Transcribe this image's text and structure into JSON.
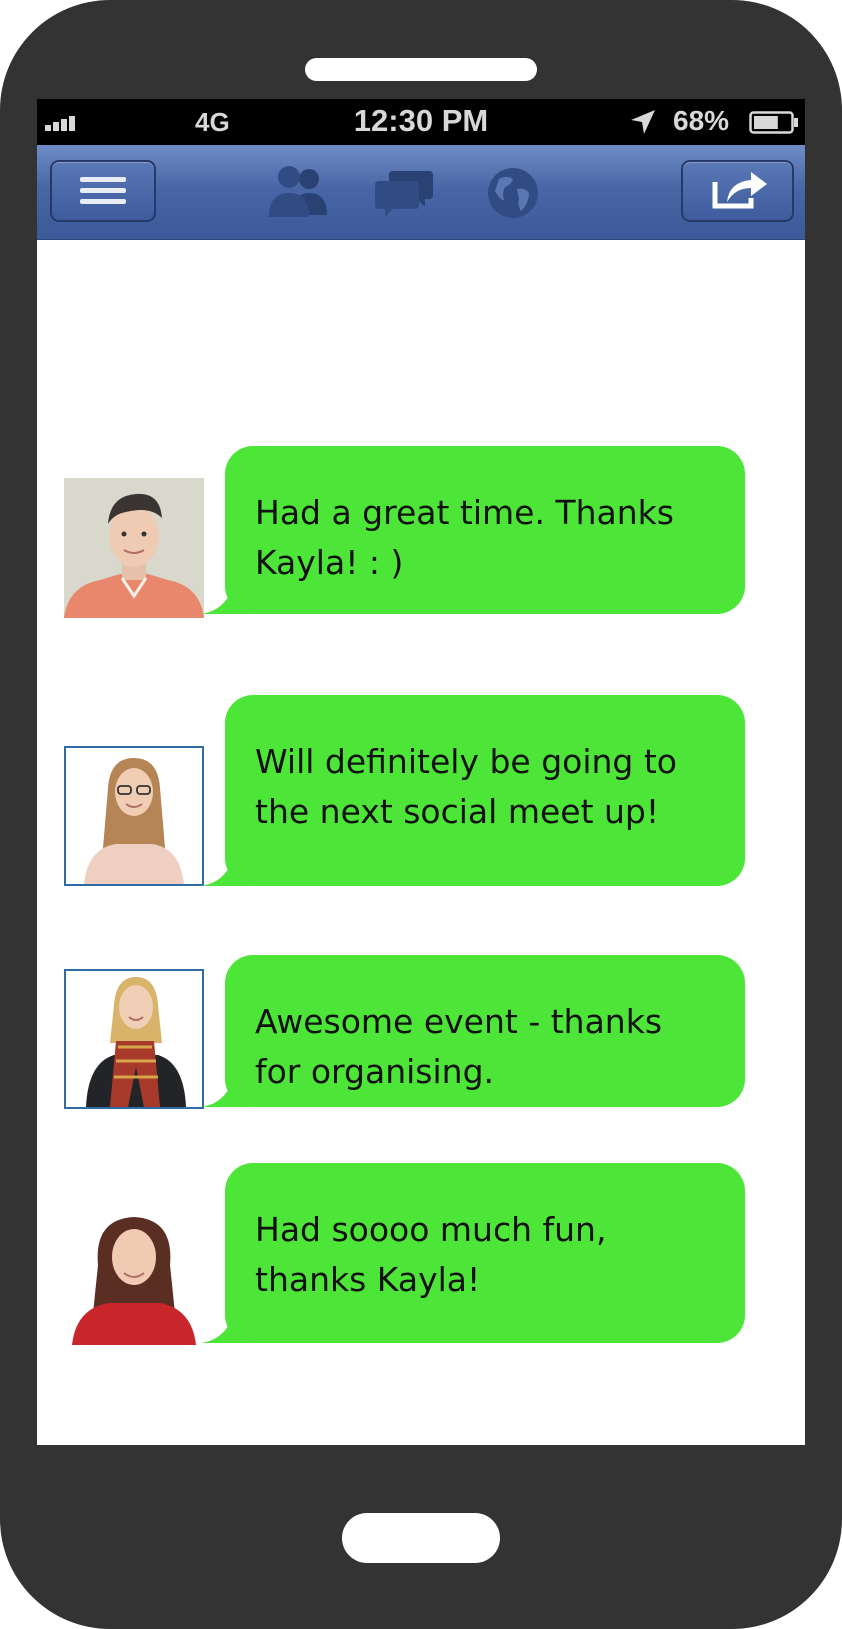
{
  "status_bar": {
    "network": "4G",
    "time": "12:30 PM",
    "battery_percent": "68%",
    "battery_level": 0.68,
    "signal_bars": 4
  },
  "nav_bar": {
    "icons": [
      "menu-icon",
      "friends-icon",
      "messages-icon",
      "globe-icon",
      "share-icon"
    ]
  },
  "colors": {
    "bubble": "#4de638",
    "nav_bar": "#3b5998",
    "phone_body": "#333333",
    "avatar_border": "#2e6da4"
  },
  "messages": [
    {
      "text": "Had a great time. Thanks Kayla! : )",
      "avatar": "young man in coral hoodie"
    },
    {
      "text": "Will definitely be going to the next social meet up!",
      "avatar": "woman with glasses and long hair"
    },
    {
      "text": "Awesome event - thanks for organising.",
      "avatar": "blonde woman in plaid scarf"
    },
    {
      "text": "Had soooo much fun, thanks Kayla!",
      "avatar": "woman with dark hair in red top"
    }
  ]
}
